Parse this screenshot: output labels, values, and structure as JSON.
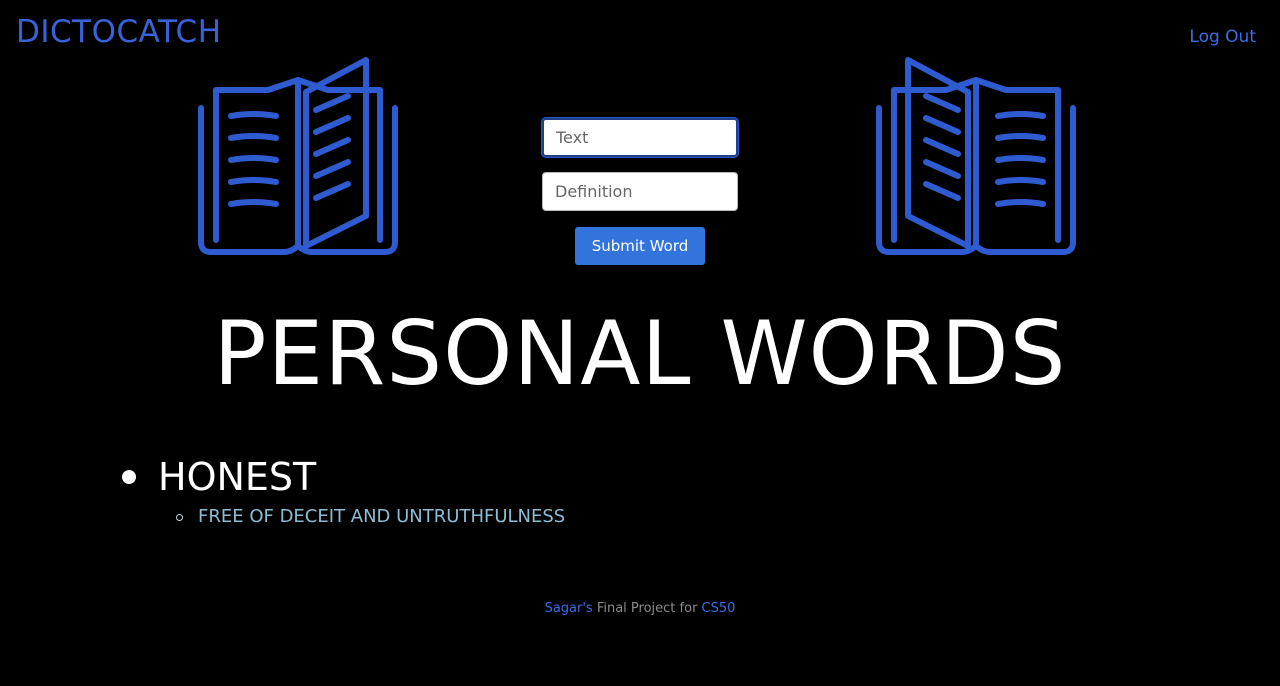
{
  "navbar": {
    "brand": "DICTOCATCH",
    "logout_label": "Log Out"
  },
  "colors": {
    "background": "#000000",
    "brand": "#3862d8",
    "link": "#3a6ee6",
    "button": "#3273dc",
    "book_icon": "#2f5bd0",
    "definition": "#8cbdd4"
  },
  "icons": {
    "left": "open-book-icon",
    "right": "open-book-icon"
  },
  "form": {
    "text_placeholder": "Text",
    "definition_placeholder": "Definition",
    "submit_label": "Submit Word"
  },
  "main": {
    "title": "PERSONAL WORDS",
    "words": [
      {
        "word": "HONEST",
        "definitions": [
          "FREE OF DECEIT AND UNTRUTHFULNESS"
        ]
      }
    ]
  },
  "footer": {
    "author": "Sagar's",
    "middle": " Final Project for ",
    "course": "CS50"
  }
}
